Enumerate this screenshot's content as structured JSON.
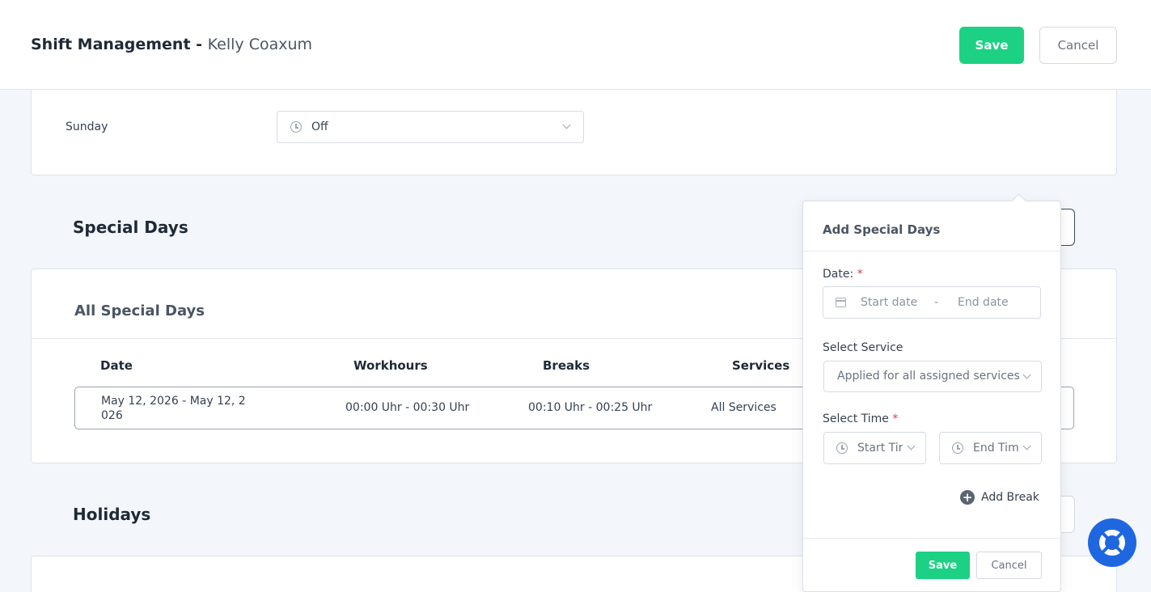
{
  "header": {
    "title": "Shift Management -",
    "employee": "Kelly Coaxum",
    "save_label": "Save",
    "cancel_label": "Cancel"
  },
  "schedule": {
    "sunday_label": "Sunday",
    "sunday_value": "Off"
  },
  "special_days": {
    "section_title": "Special Days",
    "card_title": "All Special Days",
    "columns": [
      "Date",
      "Workhours",
      "Breaks",
      "Services"
    ],
    "rows": [
      {
        "date": "May 12, 2026 - May 12, 2026",
        "workhours": "00:00 Uhr - 00:30 Uhr",
        "breaks": "00:10 Uhr - 00:25 Uhr",
        "services": "All Services"
      }
    ]
  },
  "holidays": {
    "section_title": "Holidays"
  },
  "popover": {
    "title": "Add Special Days",
    "date_label": "Date:",
    "start_date_placeholder": "Start date",
    "date_separator": "-",
    "end_date_placeholder": "End date",
    "service_label": "Select Service",
    "service_value": "Applied for all assigned services",
    "time_label": "Select Time",
    "start_time_placeholder": "Start Tir",
    "end_time_placeholder": "End Tim",
    "add_break_label": "Add Break",
    "save_label": "Save",
    "cancel_label": "Cancel",
    "required_mark": "*"
  },
  "colors": {
    "primary_green": "#1cd184",
    "help_blue": "#1f67e0",
    "required_red": "#e0394e"
  }
}
